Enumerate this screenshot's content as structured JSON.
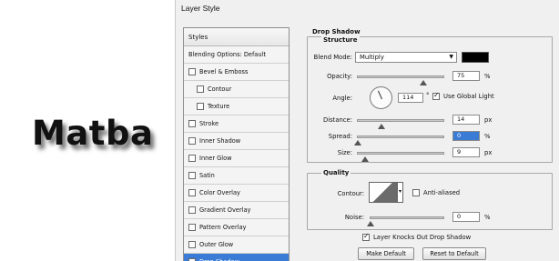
{
  "preview": {
    "text": "Matba"
  },
  "dialog": {
    "title": "Layer Style",
    "styles_header": "Styles",
    "styles_items": [
      {
        "label": "Blending Options: Default",
        "checkbox": false,
        "checked": false,
        "indent": false
      },
      {
        "label": "Bevel & Emboss",
        "checkbox": true,
        "checked": false,
        "indent": false
      },
      {
        "label": "Contour",
        "checkbox": true,
        "checked": false,
        "indent": true
      },
      {
        "label": "Texture",
        "checkbox": true,
        "checked": false,
        "indent": true
      },
      {
        "label": "Stroke",
        "checkbox": true,
        "checked": false,
        "indent": false
      },
      {
        "label": "Inner Shadow",
        "checkbox": true,
        "checked": false,
        "indent": false
      },
      {
        "label": "Inner Glow",
        "checkbox": true,
        "checked": false,
        "indent": false
      },
      {
        "label": "Satin",
        "checkbox": true,
        "checked": false,
        "indent": false
      },
      {
        "label": "Color Overlay",
        "checkbox": true,
        "checked": false,
        "indent": false
      },
      {
        "label": "Gradient Overlay",
        "checkbox": true,
        "checked": false,
        "indent": false
      },
      {
        "label": "Pattern Overlay",
        "checkbox": true,
        "checked": false,
        "indent": false
      },
      {
        "label": "Outer Glow",
        "checkbox": true,
        "checked": false,
        "indent": false
      },
      {
        "label": "Drop Shadow",
        "checkbox": true,
        "checked": true,
        "indent": false,
        "selected": true
      }
    ],
    "drop_shadow": {
      "section_title": "Drop Shadow",
      "structure_title": "Structure",
      "blend_mode_label": "Blend Mode:",
      "blend_mode_value": "Multiply",
      "blend_color": "#000000",
      "opacity_label": "Opacity:",
      "opacity_value": "75",
      "opacity_unit": "%",
      "opacity_level": 0.75,
      "angle_label": "Angle:",
      "angle_value": "114",
      "angle_unit": "°",
      "global_light_label": "Use Global Light",
      "global_light_checked": true,
      "distance_label": "Distance:",
      "distance_value": "14",
      "distance_unit": "px",
      "spread_label": "Spread:",
      "spread_value": "0",
      "spread_unit": "%",
      "size_label": "Size:",
      "size_value": "9",
      "size_unit": "px",
      "quality_title": "Quality",
      "contour_label": "Contour:",
      "anti_aliased_label": "Anti-aliased",
      "anti_aliased_checked": false,
      "noise_label": "Noise:",
      "noise_value": "0",
      "noise_unit": "%",
      "knockout_label": "Layer Knocks Out Drop Shadow",
      "knockout_checked": true,
      "make_default_label": "Make Default",
      "reset_default_label": "Reset to Default"
    }
  },
  "colors": {
    "selected": "#3a7bd5"
  }
}
